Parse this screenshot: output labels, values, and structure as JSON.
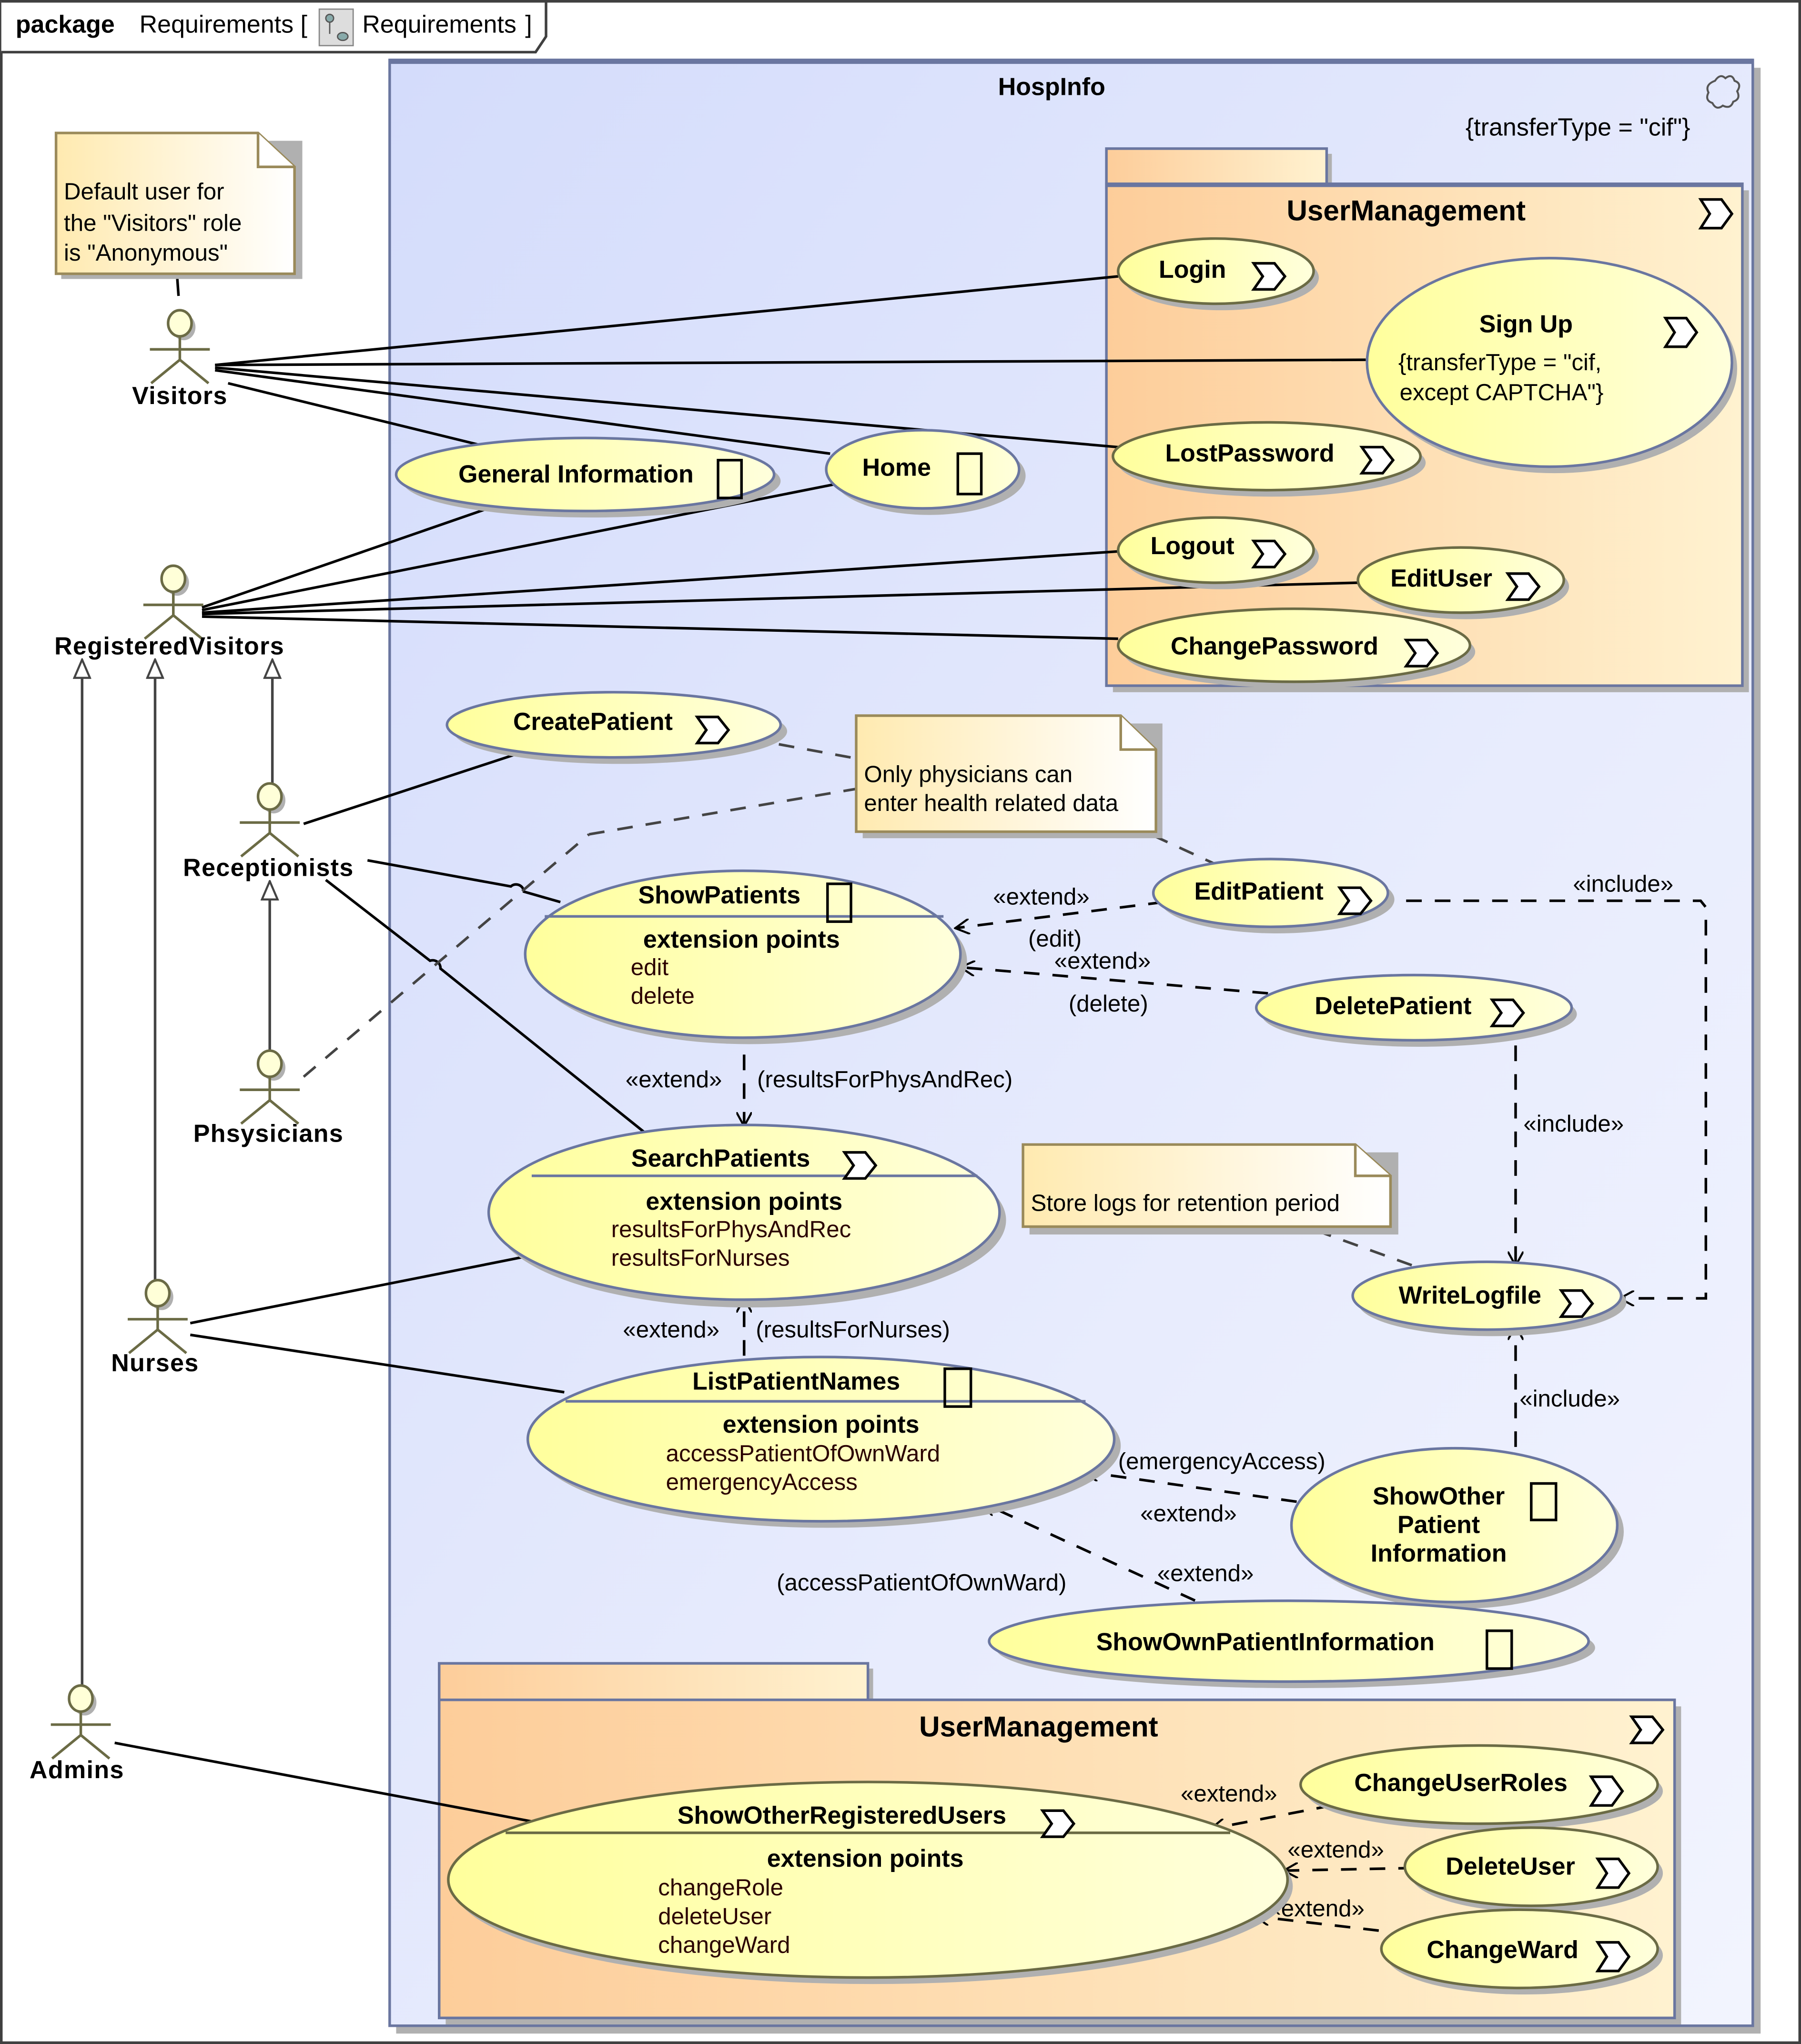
{
  "frame": {
    "keyword": "package",
    "name": "Requirements [",
    "diagram_icon": "use-case-diagram-icon",
    "diagram_name": "Requirements",
    "close_bracket": "]"
  },
  "colors": {
    "system_fill": "#d8e0fb",
    "system_border": "#6a76a0",
    "package_fill": "#fdd0a0",
    "usecase_fill": "#ffffa8",
    "note_fill": "#fff2c2",
    "note_border": "#9a8a5a",
    "actor_stroke": "#6b6b45",
    "actor_head": "#ffffd8"
  },
  "system": {
    "name": "HospInfo",
    "constraint": "{transferType = \"cif\"}",
    "icon": "subsystem-icon"
  },
  "packages": [
    {
      "name": "UserManagement",
      "icon": "package-chevron-icon"
    },
    {
      "name": "UserManagement",
      "icon": "package-chevron-icon"
    }
  ],
  "actors": [
    {
      "id": "visitors",
      "name": "Visitors"
    },
    {
      "id": "registered",
      "name": "RegisteredVisitors"
    },
    {
      "id": "receptionists",
      "name": "Receptionists"
    },
    {
      "id": "physicians",
      "name": "Phsysicians"
    },
    {
      "id": "nurses",
      "name": "Nurses"
    },
    {
      "id": "admins",
      "name": "Admins"
    }
  ],
  "notes": [
    {
      "id": "note-default-user",
      "lines": [
        "Default user for",
        "the \"Visitors\" role",
        "is \"Anonymous\""
      ]
    },
    {
      "id": "note-physicians",
      "lines": [
        "Only physicians can",
        "enter health related data"
      ]
    },
    {
      "id": "note-logs",
      "lines": [
        "Store logs for retention period"
      ]
    }
  ],
  "use_cases": {
    "login": {
      "name": "Login",
      "icon": "chevron-icon"
    },
    "signup": {
      "name": "Sign Up",
      "icon": "chevron-icon",
      "constraint_lines": [
        "{transferType = \"cif,",
        "except CAPTCHA\"}"
      ]
    },
    "lostpassword": {
      "name": "LostPassword",
      "icon": "chevron-icon"
    },
    "logout": {
      "name": "Logout",
      "icon": "chevron-icon"
    },
    "edituser": {
      "name": "EditUser",
      "icon": "chevron-icon"
    },
    "changepassword": {
      "name": "ChangePassword",
      "icon": "chevron-icon"
    },
    "generalinfo": {
      "name": "General Information",
      "icon": "box-icon"
    },
    "home": {
      "name": "Home",
      "icon": "box-icon"
    },
    "createpatient": {
      "name": "CreatePatient",
      "icon": "chevron-icon"
    },
    "showpatients": {
      "name": "ShowPatients",
      "icon": "box-icon",
      "ext_title": "extension  points",
      "ext_points": [
        "edit",
        "delete"
      ]
    },
    "editpatient": {
      "name": "EditPatient",
      "icon": "chevron-icon"
    },
    "deletepatient": {
      "name": "DeletePatient",
      "icon": "chevron-icon"
    },
    "searchpatients": {
      "name": "SearchPatients",
      "icon": "chevron-icon",
      "ext_title": "extension  points",
      "ext_points": [
        "resultsForPhysAndRec",
        "resultsForNurses"
      ]
    },
    "writelogfile": {
      "name": "WriteLogfile",
      "icon": "chevron-icon"
    },
    "listpatientnames": {
      "name": "ListPatientNames",
      "icon": "box-icon",
      "ext_title": "extension points",
      "ext_points": [
        "accessPatientOfOwnWard",
        "emergencyAccess"
      ]
    },
    "showotherpatientinfo": {
      "name_lines": [
        "ShowOther",
        "Patient",
        "Information"
      ],
      "icon": "box-icon"
    },
    "showownpatientinfo": {
      "name": "ShowOwnPatientInformation",
      "icon": "box-icon"
    },
    "showotherregisteredusers": {
      "name": "ShowOtherRegisteredUsers",
      "icon": "chevron-icon",
      "ext_title": "extension  points",
      "ext_points": [
        "changeRole",
        "deleteUser",
        "changeWard"
      ]
    },
    "changeuserroles": {
      "name": "ChangeUserRoles",
      "icon": "chevron-icon"
    },
    "deleteuser": {
      "name": "DeleteUser",
      "icon": "chevron-icon"
    },
    "changeward": {
      "name": "ChangeWard",
      "icon": "chevron-icon"
    }
  },
  "relationship_labels": {
    "extend": "«extend»",
    "include": "«include»",
    "edit_cond": "(edit)",
    "delete_cond": "(delete)",
    "phys_rec_cond": "(resultsForPhysAndRec)",
    "nurses_cond": "(resultsForNurses)",
    "emergency_cond": "(emergencyAccess)",
    "own_ward_cond": "(accessPatientOfOwnWard)"
  }
}
